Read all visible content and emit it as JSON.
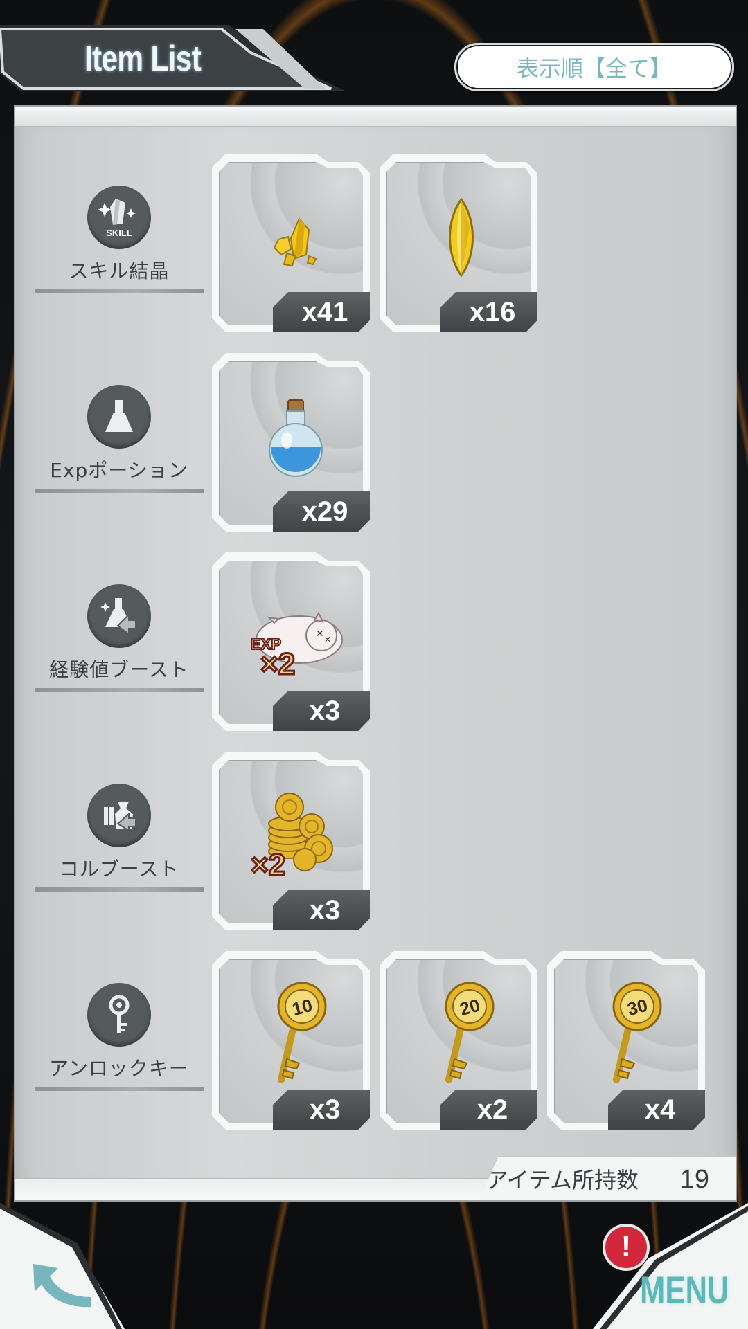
{
  "header": {
    "title": "Item List",
    "sort_button_label": "表示順【全て】"
  },
  "categories": [
    {
      "label": "スキル結晶",
      "icon": "skill-crystal-icon",
      "items": [
        {
          "name": "gold-crystal-shards",
          "count": "x41"
        },
        {
          "name": "gold-crystal-gem",
          "count": "x16"
        }
      ]
    },
    {
      "label": "Expポーション",
      "icon": "potion-flask-icon",
      "items": [
        {
          "name": "blue-exp-potion",
          "count": "x29"
        }
      ]
    },
    {
      "label": "経験値ブースト",
      "icon": "exp-boost-icon",
      "items": [
        {
          "name": "exp-x2-boost",
          "count": "x3",
          "overlay": "×2",
          "sub": "EXP"
        }
      ]
    },
    {
      "label": "コルブースト",
      "icon": "coin-boost-icon",
      "items": [
        {
          "name": "col-x2-boost",
          "count": "x3",
          "overlay": "×2"
        }
      ]
    },
    {
      "label": "アンロックキー",
      "icon": "key-icon",
      "items": [
        {
          "name": "unlock-key-10",
          "count": "x3",
          "key_number": "10"
        },
        {
          "name": "unlock-key-20",
          "count": "x2",
          "key_number": "20"
        },
        {
          "name": "unlock-key-30",
          "count": "x4",
          "key_number": "30"
        }
      ]
    }
  ],
  "footer": {
    "item_count_label": "アイテム所持数",
    "item_count_value": "19",
    "menu_label": "MENU",
    "alert_mark": "!"
  },
  "colors": {
    "accent_teal": "#5fb8b8",
    "alert_red": "#d3283b",
    "gold": "#e3b52a",
    "potion_blue": "#3d97dc"
  }
}
